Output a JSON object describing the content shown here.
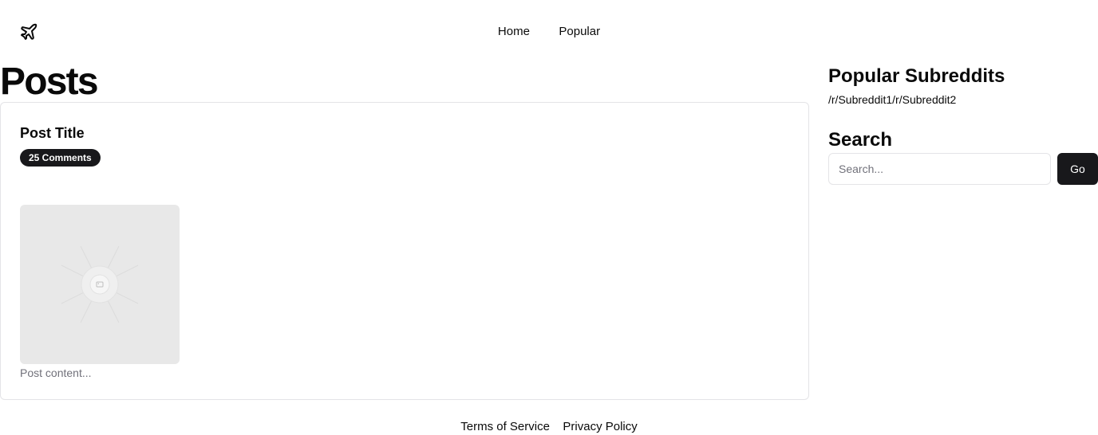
{
  "header": {
    "logo_icon": "plane-icon",
    "nav": [
      {
        "label": "Home"
      },
      {
        "label": "Popular"
      }
    ]
  },
  "main": {
    "heading": "Posts",
    "posts": [
      {
        "title": "Post Title",
        "comments_badge": "25 Comments",
        "image_icon": "image-placeholder-icon",
        "content": "Post content..."
      }
    ]
  },
  "sidebar": {
    "popular_heading": "Popular Subreddits",
    "subreddits": [
      "/r/Subreddit1",
      "/r/Subreddit2"
    ],
    "search_heading": "Search",
    "search_placeholder": "Search...",
    "search_button": "Go"
  },
  "footer": {
    "links": [
      {
        "label": "Terms of Service"
      },
      {
        "label": "Privacy Policy"
      }
    ]
  },
  "colors": {
    "primary": "#18181b",
    "border": "#e4e4e7",
    "muted_text": "#71717a",
    "image_placeholder": "#e8e8e8"
  }
}
